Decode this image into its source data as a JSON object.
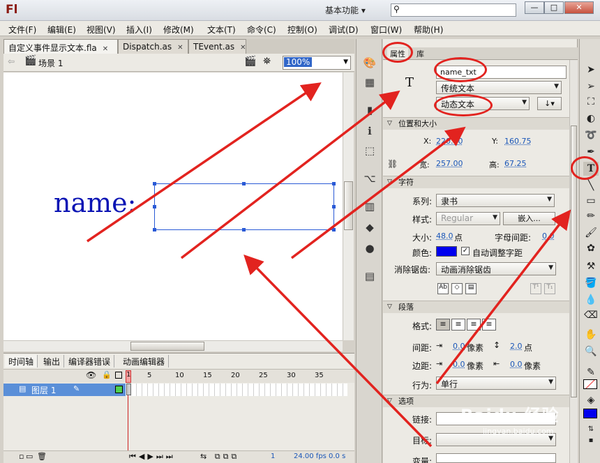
{
  "app": {
    "logo": "Fl",
    "workspace": "基本功能 ▾",
    "window_buttons": [
      "—",
      "□",
      "✕"
    ]
  },
  "menu": [
    "文件(F)",
    "编辑(E)",
    "视图(V)",
    "插入(I)",
    "修改(M)",
    "文本(T)",
    "命令(C)",
    "控制(O)",
    "调试(D)",
    "窗口(W)",
    "帮助(H)"
  ],
  "doc_tabs": [
    {
      "label": "自定义事件显示文本.fla",
      "close": "✕"
    },
    {
      "label": "Dispatch.as",
      "close": "✕"
    },
    {
      "label": "TEvent.as",
      "close": "✕"
    }
  ],
  "stage_bar": {
    "scene": "场景 1",
    "zoom": "100%"
  },
  "stage": {
    "label_text": "name:"
  },
  "timeline": {
    "tabs": [
      "时间轴",
      "输出",
      "编译器错误",
      "动画编辑器"
    ],
    "frame_numbers": [
      "1",
      "5",
      "10",
      "15",
      "20",
      "25",
      "30",
      "35"
    ],
    "layer_name": "图层 1",
    "current_frame": "1",
    "fps": "24.00 fps",
    "time": "0.0 s"
  },
  "properties": {
    "tabs": [
      "属性",
      "库"
    ],
    "instance_name": "name_txt",
    "text_engine": "传统文本",
    "text_type": "动态文本",
    "text_icon": "T",
    "position_size": {
      "header": "位置和大小",
      "x_label": "X:",
      "x_value": "220.00",
      "y_label": "Y:",
      "y_value": "160.75",
      "w_label": "宽:",
      "w_value": "257.00",
      "h_label": "高:",
      "h_value": "67.25"
    },
    "character": {
      "header": "字符",
      "family_label": "系列:",
      "family_value": "隶书",
      "style_label": "样式:",
      "style_value": "Regular",
      "embed_button": "嵌入...",
      "size_label": "大小:",
      "size_value": "48.0",
      "size_unit": "点",
      "spacing_label": "字母间距:",
      "spacing_value": "0.0",
      "color_label": "颜色:",
      "color_value": "#0000ee",
      "auto_kern_label": "自动调整字距",
      "aa_label": "消除锯齿:",
      "aa_value": "动画消除锯齿"
    },
    "paragraph": {
      "header": "段落",
      "format_label": "格式:",
      "spacing_label": "间距:",
      "indent_value": "0.0",
      "indent_unit": "像素",
      "line_spacing_value": "2.0",
      "line_spacing_unit": "点",
      "margin_label": "边距:",
      "left_margin_value": "0.0",
      "left_margin_unit": "像素",
      "right_margin_value": "0.0",
      "right_margin_unit": "像素",
      "behavior_label": "行为:",
      "behavior_value": "单行"
    },
    "options": {
      "header": "选项",
      "link_label": "链接:",
      "target_label": "目标:",
      "variable_label": "变量:"
    }
  },
  "watermark": {
    "main": "Baidu 经验",
    "sub": "jingyan.baidu.com"
  },
  "colors": {
    "annotation_red": "#e2231f",
    "stage_text": "#0a14b4",
    "selection_blue": "#2a5ad6"
  }
}
